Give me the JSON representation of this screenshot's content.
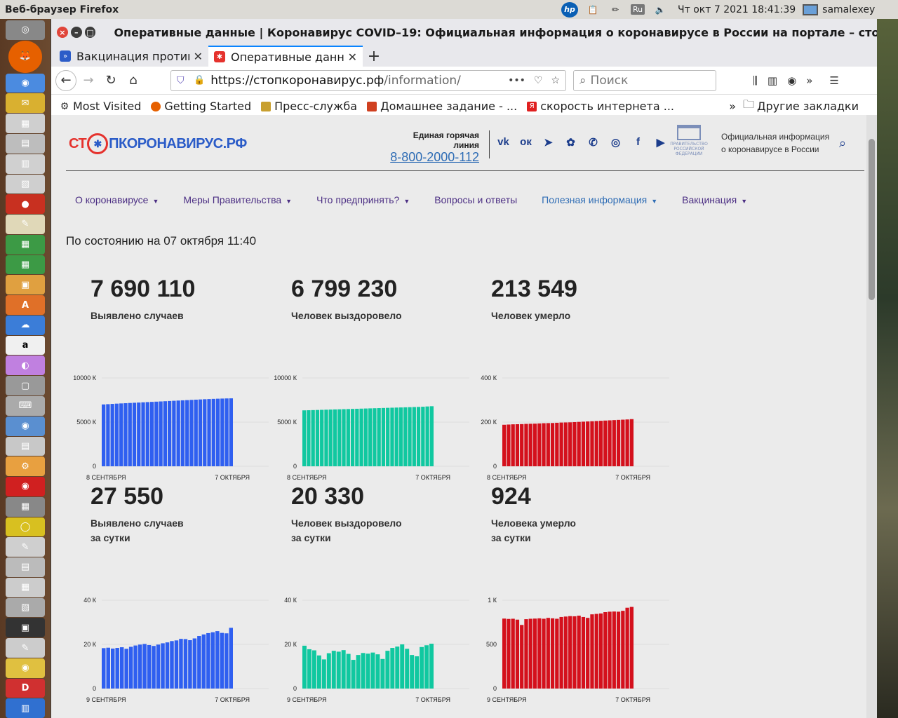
{
  "os": {
    "app_title": "Веб-браузер Firefox",
    "clock": "Чт окт  7 2021 18:41:39",
    "user": "samalexey",
    "kbd_layout": "Ru"
  },
  "browser": {
    "window_title": "Оперативные данные | Коронавирус COVID–19: Официальная информация о коронавирусе в России на портале – стопкоронавирус",
    "tabs": [
      {
        "label": "Вакцинация против"
      },
      {
        "label": "Оперативные данны"
      }
    ],
    "url_host": "https://стопкоронавирус.рф",
    "url_path": "/information/",
    "search_placeholder": "Поиск",
    "bookmarks": [
      {
        "label": "Most Visited"
      },
      {
        "label": "Getting Started"
      },
      {
        "label": "Пресс-служба"
      },
      {
        "label": "Домашнее задание - ..."
      },
      {
        "label": "скорость интернета ..."
      }
    ],
    "other_bookmarks": "Другие закладки"
  },
  "site": {
    "logo_part1": "СТ",
    "logo_part2": "ПКОРОНАВИРУС.РФ",
    "hotline_label": "Единая горячая линия",
    "hotline_phone": "8-800-2000-112",
    "official_line1": "Официальная информация",
    "official_line2": "о коронавирусе в России",
    "gov_text": "ПРАВИТЕЛЬСТВО РОССИЙСКОЙ ФЕДЕРАЦИИ",
    "nav": [
      {
        "label": "О коронавирусе",
        "color": "#4b2e83"
      },
      {
        "label": "Меры Правительства",
        "color": "#4b2e83"
      },
      {
        "label": "Что предпринять?",
        "color": "#4b2e83"
      },
      {
        "label": "Вопросы и ответы",
        "color": "#4b2e83"
      },
      {
        "label": "Полезная информация",
        "color": "#2f6db5"
      },
      {
        "label": "Вакцинация",
        "color": "#4b2e83"
      }
    ],
    "as_of": "По состоянию на 07 октября 11:40"
  },
  "stats": [
    {
      "value": "7 690 110",
      "label1": "Выявлено случаев",
      "label2": ""
    },
    {
      "value": "6 799 230",
      "label1": "Человек выздоровело",
      "label2": ""
    },
    {
      "value": "213 549",
      "label1": "Человек умерло",
      "label2": ""
    },
    {
      "value": "27 550",
      "label1": "Выявлено случаев",
      "label2": "за сутки"
    },
    {
      "value": "20 330",
      "label1": "Человек выздоровело",
      "label2": "за сутки"
    },
    {
      "value": "924",
      "label1": "Человека умерло",
      "label2": "за сутки"
    }
  ],
  "chart_data": [
    {
      "type": "bar",
      "color": "#2f5ff0",
      "x_start": "8 СЕНТЯБРЯ",
      "x_end": "7 ОКТЯБРЯ",
      "ylim": [
        0,
        10000
      ],
      "yticks": [
        "10000 К",
        "5000 К",
        "0"
      ],
      "values": [
        7000,
        7030,
        7060,
        7090,
        7115,
        7140,
        7165,
        7190,
        7215,
        7240,
        7265,
        7290,
        7315,
        7340,
        7365,
        7390,
        7415,
        7440,
        7465,
        7490,
        7515,
        7540,
        7565,
        7590,
        7610,
        7630,
        7650,
        7665,
        7680,
        7690
      ]
    },
    {
      "type": "bar",
      "color": "#10c8a0",
      "x_start": "8 СЕНТЯБРЯ",
      "x_end": "7 ОКТЯБРЯ",
      "ylim": [
        0,
        10000
      ],
      "yticks": [
        "10000 К",
        "5000 К",
        "0"
      ],
      "values": [
        6330,
        6345,
        6360,
        6375,
        6390,
        6405,
        6420,
        6435,
        6450,
        6465,
        6480,
        6495,
        6510,
        6525,
        6540,
        6555,
        6570,
        6585,
        6600,
        6615,
        6630,
        6645,
        6660,
        6675,
        6690,
        6705,
        6720,
        6740,
        6770,
        6799
      ]
    },
    {
      "type": "bar",
      "color": "#d4101c",
      "x_start": "8 СЕНТЯБРЯ",
      "x_end": "7 ОКТЯБРЯ",
      "ylim": [
        0,
        400
      ],
      "yticks": [
        "400 К",
        "200 К",
        "0"
      ],
      "values": [
        188,
        189,
        190,
        190.5,
        191,
        192,
        192.5,
        193,
        194,
        195,
        195.5,
        196,
        197,
        198,
        198.5,
        199,
        200,
        201,
        202,
        203,
        204,
        205,
        206,
        207,
        208,
        209,
        210,
        211,
        212,
        213.5
      ]
    },
    {
      "type": "bar",
      "color": "#2f5ff0",
      "x_start": "9 СЕНТЯБРЯ",
      "x_end": "7 ОКТЯБРЯ",
      "ylim": [
        0,
        40
      ],
      "yticks": [
        "40 К",
        "20 К",
        "0"
      ],
      "values": [
        18.3,
        18.5,
        18.1,
        18.4,
        18.7,
        18.0,
        18.9,
        19.5,
        19.9,
        20.2,
        19.7,
        19.3,
        19.9,
        20.5,
        20.9,
        21.5,
        21.8,
        22.5,
        22.4,
        21.9,
        22.7,
        23.8,
        24.5,
        25.1,
        25.5,
        26.0,
        25.2,
        25.0,
        27.5
      ]
    },
    {
      "type": "bar",
      "color": "#10c8a0",
      "x_start": "9 СЕНТЯБРЯ",
      "x_end": "7 ОКТЯБРЯ",
      "ylim": [
        0,
        40
      ],
      "yticks": [
        "40 К",
        "20 К",
        "0"
      ],
      "values": [
        19.4,
        17.8,
        17.3,
        15.0,
        13.2,
        16.0,
        17.1,
        16.7,
        17.4,
        15.7,
        13.0,
        15.2,
        16.1,
        15.8,
        16.3,
        15.5,
        13.4,
        17.1,
        18.4,
        19.0,
        20.0,
        18.0,
        15.2,
        14.6,
        18.8,
        19.6,
        20.3
      ]
    },
    {
      "type": "bar",
      "color": "#d4101c",
      "x_start": "9 СЕНТЯБРЯ",
      "x_end": "7 ОКТЯБРЯ",
      "ylim": [
        0,
        1000
      ],
      "yticks": [
        "1 К",
        "500",
        "0"
      ],
      "values": [
        792,
        788,
        790,
        780,
        720,
        785,
        790,
        792,
        795,
        790,
        800,
        795,
        790,
        810,
        815,
        820,
        818,
        825,
        810,
        800,
        840,
        845,
        850,
        865,
        870,
        872,
        870,
        880,
        915,
        924
      ]
    }
  ]
}
